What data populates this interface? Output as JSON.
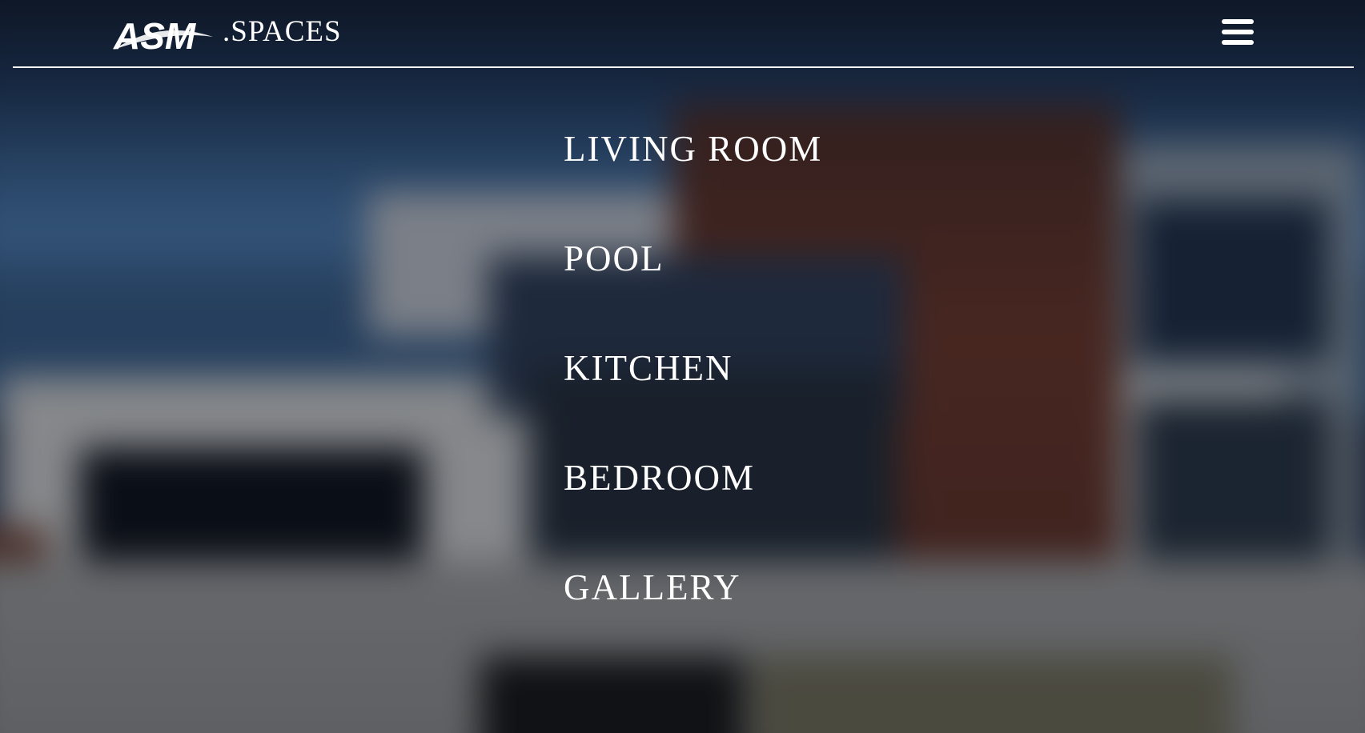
{
  "brand": {
    "logo_text": "ASM",
    "suffix": ".SPACES"
  },
  "header": {
    "menu_icon": "hamburger-menu-icon"
  },
  "nav": {
    "items": [
      {
        "label": "LIVING ROOM"
      },
      {
        "label": "POOL"
      },
      {
        "label": "KITCHEN"
      },
      {
        "label": "BEDROOM"
      },
      {
        "label": "GALLERY"
      }
    ]
  },
  "colors": {
    "text": "#ffffff",
    "overlay": "#1b2a44"
  }
}
